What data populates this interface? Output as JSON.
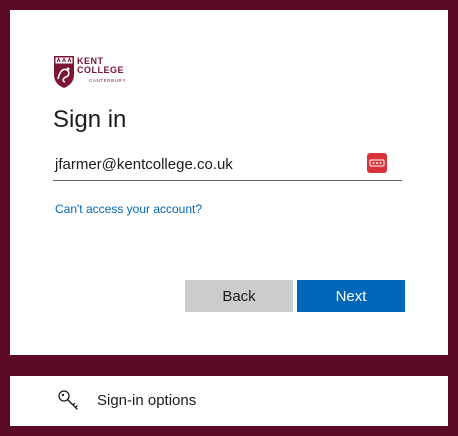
{
  "brand": {
    "name_line1": "KENT",
    "name_line2": "COLLEGE",
    "name_line3": "CANTERBURY",
    "logo_icon": "crest-icon",
    "color": "#7a1631"
  },
  "signin": {
    "title": "Sign in",
    "email_value": "jfarmer@kentcollege.co.uk",
    "password_manager_icon": "password-manager-icon",
    "cant_access_link": "Can't access your account?",
    "back_label": "Back",
    "next_label": "Next"
  },
  "options": {
    "label": "Sign-in options",
    "icon": "key-icon"
  },
  "colors": {
    "background": "#5a0a23",
    "accent": "#0067b8",
    "back_button": "#cccccc"
  }
}
